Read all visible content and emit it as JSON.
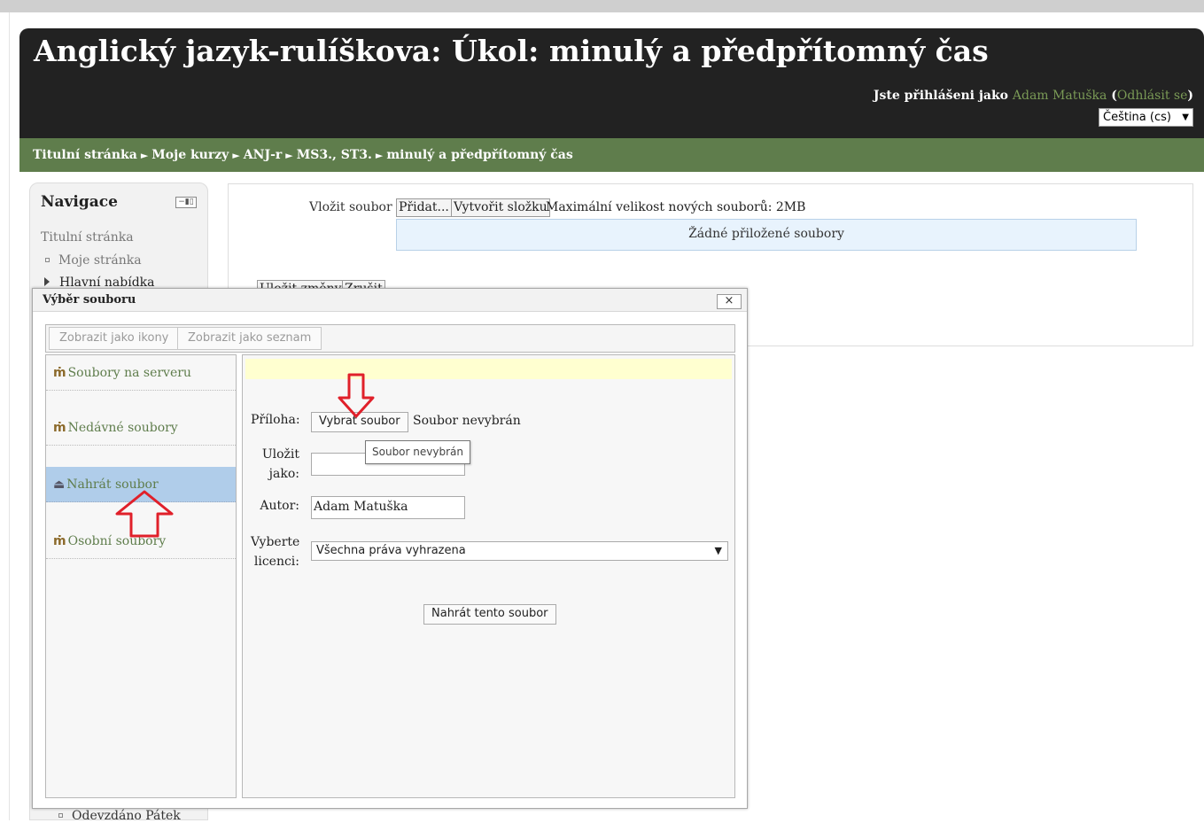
{
  "header": {
    "title": "Anglický jazyk-rulíškova: Úkol: minulý a předpřítomný čas",
    "login_prefix": "Jste přihlášeni jako",
    "user_name": "Adam Matuška",
    "logout_label": "Odhlásit se",
    "language": "Čeština (cs)"
  },
  "breadcrumb": {
    "items": [
      "Titulní stránka",
      "Moje kurzy",
      "ANJ-r",
      "MS3., ST3.",
      "minulý a předpřítomný čas"
    ],
    "separator": "►"
  },
  "navigation": {
    "title": "Navigace",
    "home": "Titulní stránka",
    "my_page": "Moje stránka",
    "main_menu": "Hlavní nabídka",
    "bottom_item": "Odevzdáno Pátek"
  },
  "main": {
    "file_label": "Vložit soubor",
    "add_button": "Přidat...",
    "create_folder_button": "Vytvořit složku",
    "max_size": "Maximální velikost nových souborů: 2MB",
    "no_files": "Žádné přiložené soubory",
    "save_button": "Uložit změny",
    "cancel_button": "Zrušit"
  },
  "dialog": {
    "title": "Výběr souboru",
    "close_label": "×",
    "view_icons": "Zobrazit jako ikony",
    "view_list": "Zobrazit jako seznam",
    "repositories": [
      {
        "label": "Soubory na serveru",
        "icon": "moodle-icon",
        "active": false
      },
      {
        "label": "Nedávné soubory",
        "icon": "moodle-icon",
        "active": false
      },
      {
        "label": "Nahrát soubor",
        "icon": "upload-icon",
        "active": true
      },
      {
        "label": "Osobní soubory",
        "icon": "moodle-icon",
        "active": false
      }
    ],
    "form": {
      "attachment_label": "Příloha:",
      "choose_file_button": "Vybrat soubor",
      "no_file_text": "Soubor nevybrán",
      "tooltip": "Soubor nevybrán",
      "save_as_label_1": "Uložit",
      "save_as_label_2": "jako:",
      "save_as_value": "",
      "author_label": "Autor:",
      "author_value": "Adam Matuška",
      "license_label_1": "Vyberte",
      "license_label_2": "licenci:",
      "license_value": "Všechna práva vyhrazena",
      "upload_button": "Nahrát tento soubor"
    }
  },
  "colors": {
    "header_bg": "#222222",
    "breadcrumb_bg": "#5f7d4c",
    "link_green": "#7a9a56",
    "active_repo": "#b0cdea",
    "annotation_red": "#e0202a"
  }
}
